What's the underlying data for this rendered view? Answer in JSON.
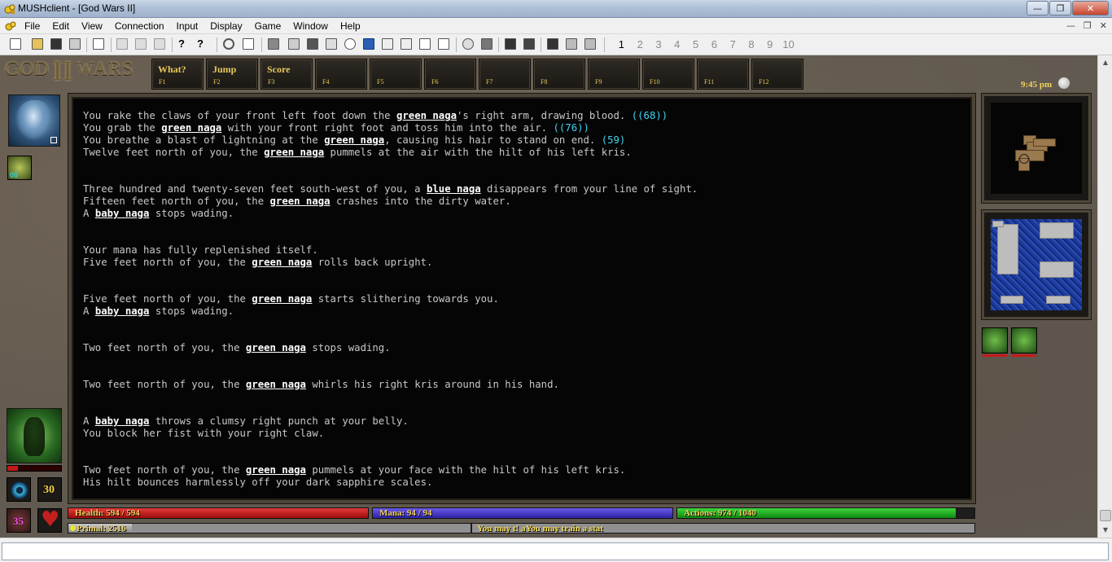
{
  "window": {
    "title": "MUSHclient - [God Wars II]"
  },
  "menu": [
    "File",
    "Edit",
    "View",
    "Connection",
    "Input",
    "Display",
    "Game",
    "Window",
    "Help"
  ],
  "world_tabs": [
    "1",
    "2",
    "3",
    "4",
    "5",
    "6",
    "7",
    "8",
    "9",
    "10"
  ],
  "logo": {
    "left": "GOD",
    "mid": "II",
    "right": "WARS"
  },
  "fkeys": [
    {
      "label": "What?",
      "key": "F1"
    },
    {
      "label": "Jump",
      "key": "F2"
    },
    {
      "label": "Score",
      "key": "F3"
    },
    {
      "label": "",
      "key": "F4"
    },
    {
      "label": "",
      "key": "F5"
    },
    {
      "label": "",
      "key": "F6"
    },
    {
      "label": "",
      "key": "F7"
    },
    {
      "label": "",
      "key": "F8"
    },
    {
      "label": "",
      "key": "F9"
    },
    {
      "label": "",
      "key": "F10"
    },
    {
      "label": "",
      "key": "F11"
    },
    {
      "label": "",
      "key": "F12"
    }
  ],
  "clock": "9:45 pm",
  "affect_icon_text": "00",
  "stats": {
    "weapon_value": "30",
    "mana_orb_value": "35",
    "health": "Health: 594 / 594",
    "health_fraction": 1.0,
    "mana": "Mana: 94 / 94",
    "mana_fraction": 1.0,
    "actions": "Actions: 974 / 1040",
    "actions_fraction": 0.937,
    "primal": "Primal: 2516",
    "primal_fraction": 0.07,
    "train_message": "You may t! aYou may train a stat",
    "target_health_fraction": 0.2
  },
  "output": [
    [
      [
        "You rake the claws of your front left foot down the ",
        ""
      ],
      [
        "green naga",
        "n"
      ],
      [
        "'s right arm, drawing blood. ",
        ""
      ],
      [
        "((68))",
        "c"
      ]
    ],
    [
      [
        "You grab the ",
        ""
      ],
      [
        "green naga",
        "n"
      ],
      [
        " with your front right foot and toss him into the air. ",
        ""
      ],
      [
        "((76))",
        "c"
      ]
    ],
    [
      [
        "You breathe a blast of lightning at the ",
        ""
      ],
      [
        "green naga",
        "n"
      ],
      [
        ", causing his hair to stand on end. ",
        ""
      ],
      [
        "(59)",
        "c"
      ]
    ],
    [
      [
        "Twelve feet north of you, the ",
        ""
      ],
      [
        "green naga",
        "n"
      ],
      [
        " pummels at the air with the hilt of his left kris.",
        ""
      ]
    ],
    [],
    [],
    [
      [
        "Three hundred and twenty-seven feet south-west of you, a ",
        ""
      ],
      [
        "blue naga",
        "n"
      ],
      [
        " disappears from your line of sight.",
        ""
      ]
    ],
    [
      [
        "Fifteen feet north of you, the ",
        ""
      ],
      [
        "green naga",
        "n"
      ],
      [
        " crashes into the dirty water.",
        ""
      ]
    ],
    [
      [
        "A ",
        ""
      ],
      [
        "baby naga",
        "n"
      ],
      [
        " stops wading.",
        ""
      ]
    ],
    [],
    [],
    [
      [
        "Your mana has fully replenished itself.",
        ""
      ]
    ],
    [
      [
        "Five feet north of you, the ",
        ""
      ],
      [
        "green naga",
        "n"
      ],
      [
        " rolls back upright.",
        ""
      ]
    ],
    [],
    [],
    [
      [
        "Five feet north of you, the ",
        ""
      ],
      [
        "green naga",
        "n"
      ],
      [
        " starts slithering towards you.",
        ""
      ]
    ],
    [
      [
        "A ",
        ""
      ],
      [
        "baby naga",
        "n"
      ],
      [
        " stops wading.",
        ""
      ]
    ],
    [],
    [],
    [
      [
        "Two feet north of you, the ",
        ""
      ],
      [
        "green naga",
        "n"
      ],
      [
        " stops wading.",
        ""
      ]
    ],
    [],
    [],
    [
      [
        "Two feet north of you, the ",
        ""
      ],
      [
        "green naga",
        "n"
      ],
      [
        " whirls his right kris around in his hand.",
        ""
      ]
    ],
    [],
    [],
    [
      [
        "A ",
        ""
      ],
      [
        "baby naga",
        "n"
      ],
      [
        " throws a clumsy right punch at your belly.",
        ""
      ]
    ],
    [
      [
        "You block her fist with your right claw.",
        ""
      ]
    ],
    [],
    [],
    [
      [
        "Two feet north of you, the ",
        ""
      ],
      [
        "green naga",
        "n"
      ],
      [
        " pummels at your face with the hilt of his left kris.",
        ""
      ]
    ],
    [
      [
        "His hilt bounces harmlessly off your dark sapphire scales.",
        ""
      ]
    ]
  ],
  "command_input": {
    "value": ""
  },
  "colors": {
    "name_highlight": "#ffffff",
    "damage": "#3fd4f0",
    "text": "#c8c8c8",
    "bar_label": "#f0d060"
  }
}
